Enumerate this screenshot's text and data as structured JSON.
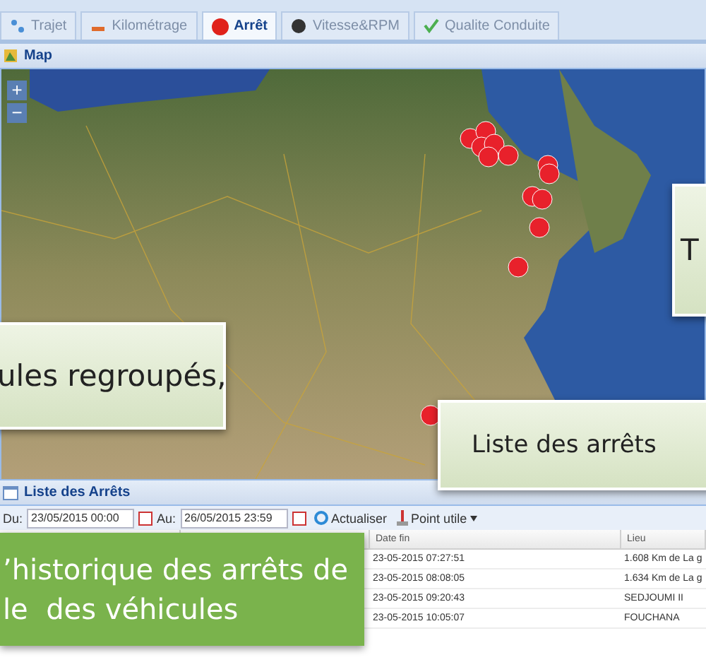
{
  "tabs": [
    {
      "label": "Trajet",
      "selected": false
    },
    {
      "label": "Kilométrage",
      "selected": false
    },
    {
      "label": "Arrêt",
      "selected": true
    },
    {
      "label": "Vitesse&RPM",
      "selected": false
    },
    {
      "label": "Qualite Conduite",
      "selected": false
    }
  ],
  "map_panel": {
    "title": "Map",
    "zoom_in": "+",
    "zoom_out": "−"
  },
  "stops_panel": {
    "title": "Liste des Arrêts",
    "toolbar": {
      "from_label": "Du:",
      "from_value": "23/05/2015 00:00",
      "to_label": "Au:",
      "to_value": "26/05/2015 23:59",
      "refresh": "Actualiser",
      "point": "Point utile"
    },
    "columns": [
      null,
      null,
      "Date fin",
      "Lieu"
    ],
    "rows": [
      {
        "cells": [
          null,
          null,
          "23-05-2015 07:27:51",
          "1.608 Km de La g"
        ]
      },
      {
        "cells": [
          null,
          null,
          "23-05-2015 08:08:05",
          "1.634 Km de La g"
        ]
      },
      {
        "cells": [
          null,
          null,
          "23-05-2015 09:20:43",
          "SEDJOUMI II"
        ]
      },
      {
        "cells": [
          null,
          null,
          "23-05-2015 10:05:07",
          "FOUCHANA"
        ]
      }
    ]
  },
  "callouts": [
    {
      "kind": "pale",
      "text": "T"
    },
    {
      "kind": "pale",
      "text": "ules regroupés,"
    },
    {
      "kind": "pale",
      "text": "Liste des arrêts"
    },
    {
      "kind": "green",
      "lines": [
        "’historique des arrêts de",
        "le  des véhicules"
      ]
    }
  ]
}
